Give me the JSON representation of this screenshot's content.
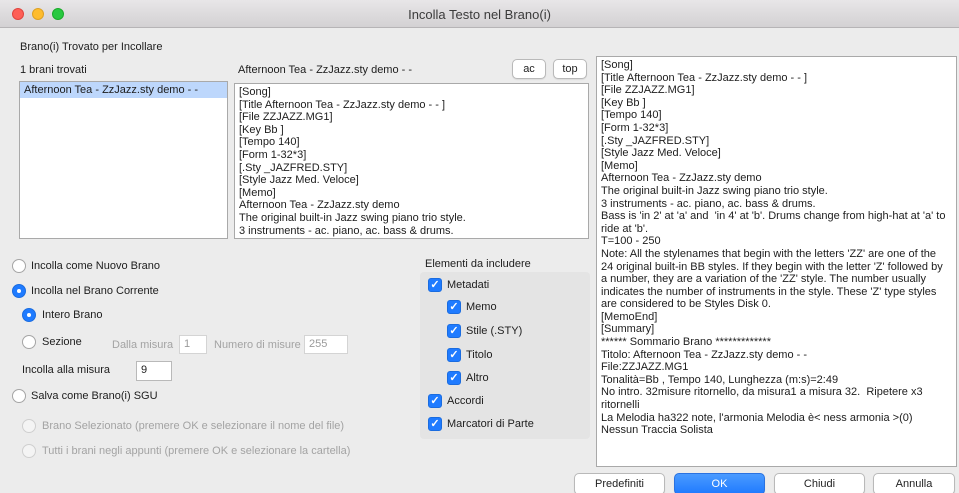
{
  "window": {
    "title": "Incolla Testo nel Brano(i)"
  },
  "section_title": "Brano(i) Trovato per Incollare",
  "songs": {
    "count_label": "1 brani trovati",
    "items": [
      "Afternoon Tea - ZzJazz.sty demo - -"
    ]
  },
  "preview": {
    "title": "Afternoon Tea - ZzJazz.sty demo - -",
    "ac_button": "ac",
    "top_button": "top",
    "lines": [
      "[Song]",
      "[Title Afternoon Tea - ZzJazz.sty demo - - ]",
      "[File ZZJAZZ.MG1]",
      "[Key Bb ]",
      "[Tempo 140]",
      "[Form 1-32*3]",
      "[.Sty _JAZFRED.STY]",
      "[Style Jazz Med. Veloce]",
      "[Memo]",
      "Afternoon Tea - ZzJazz.sty demo",
      "The original built-in Jazz swing piano trio style.",
      "3 instruments - ac. piano, ac. bass & drums."
    ]
  },
  "right_text": {
    "lines": [
      "[Song]",
      "[Title Afternoon Tea - ZzJazz.sty demo - - ]",
      "[File ZZJAZZ.MG1]",
      "[Key Bb ]",
      "[Tempo 140]",
      "[Form 1-32*3]",
      "[.Sty _JAZFRED.STY]",
      "[Style Jazz Med. Veloce]",
      "[Memo]",
      "Afternoon Tea - ZzJazz.sty demo",
      "The original built-in Jazz swing piano trio style.",
      "3 instruments - ac. piano, ac. bass & drums.",
      "Bass is 'in 2' at 'a' and  'in 4' at 'b'. Drums change from high-hat at 'a' to",
      "ride at 'b'.",
      "T=100 - 250",
      "Note: All the stylenames that begin with the letters 'ZZ' are one of the",
      "24 original built-in BB styles. If they begin with the letter 'Z' followed by",
      "a number, they are a variation of the 'ZZ' style. The number usually",
      "indicates the number of instruments in the style. These 'Z' type styles",
      "are considered to be Styles Disk 0.",
      "[MemoEnd]",
      "[Summary]",
      "****** Sommario Brano *************",
      "Titolo: Afternoon Tea - ZzJazz.sty demo - -",
      "File:ZZJAZZ.MG1",
      "Tonalità=Bb , Tempo 140, Lunghezza (m:s)=2:49",
      "No intro. 32misure ritornello, da misura1 a misura 32.  Ripetere x3",
      "ritornelli",
      "La Melodia ha322 note, l'armonia Melodia è< ness armonia >(0)",
      "Nessun Traccia Solista"
    ]
  },
  "paste_options": {
    "new_song": "Incolla come Nuovo Brano",
    "current_song": "Incolla nel Brano Corrente",
    "whole_song": "Intero Brano",
    "section": "Sezione",
    "from_bar_label": "Dalla misura",
    "from_bar_value": "1",
    "num_bars_label": "Numero di misure",
    "num_bars_value": "255",
    "paste_at_label": "Incolla alla misura",
    "paste_at_value": "9",
    "save_sgu": "Salva come Brano(i) SGU",
    "selected_song": "Brano Selezionato (premere OK e selezionare il nome del file)",
    "all_songs": "Tutti i brani negli appunti (premere OK e selezionare la cartella)"
  },
  "include": {
    "title": "Elementi da includere",
    "metadata": "Metadati",
    "memo": "Memo",
    "style": "Stile (.STY)",
    "title_item": "Titolo",
    "other": "Altro",
    "chords": "Accordi",
    "part_markers": "Marcatori di Parte"
  },
  "buttons": {
    "defaults": "Predefiniti",
    "ok": "OK",
    "close": "Chiudi",
    "cancel": "Annulla"
  },
  "colors": {
    "accent": "#1f7bff",
    "selection": "#bdd7fc"
  },
  "icons": {
    "check": "✓"
  }
}
